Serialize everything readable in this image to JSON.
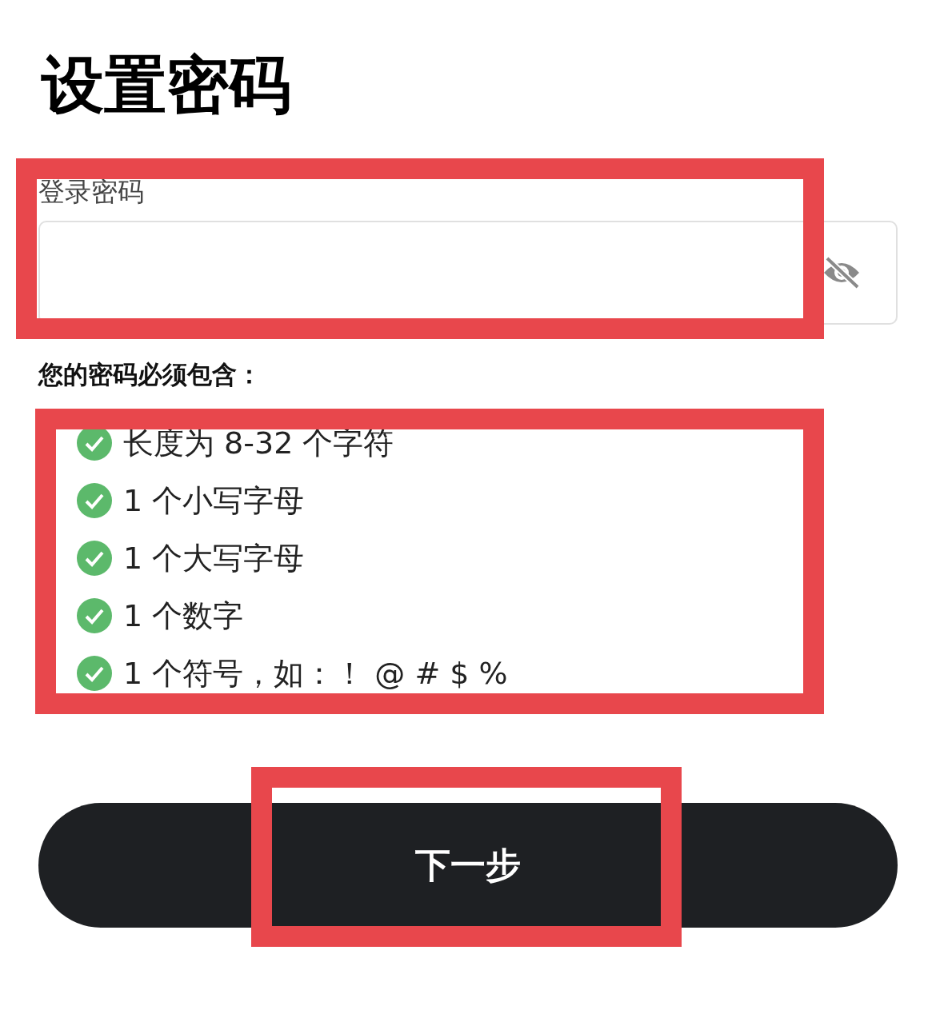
{
  "title": "设置密码",
  "password": {
    "label": "登录密码",
    "highlighted": true
  },
  "requirements": {
    "heading": "您的密码必须包含：",
    "highlighted": true,
    "items": [
      {
        "text": "长度为 8-32 个字符",
        "met": true
      },
      {
        "text": "1 个小写字母",
        "met": true
      },
      {
        "text": "1 个大写字母",
        "met": true
      },
      {
        "text": "1 个数字",
        "met": true
      },
      {
        "text": "1 个符号，如：！ @ # $ %",
        "met": true
      }
    ]
  },
  "next_button": {
    "label": "下一步",
    "highlighted": true
  }
}
